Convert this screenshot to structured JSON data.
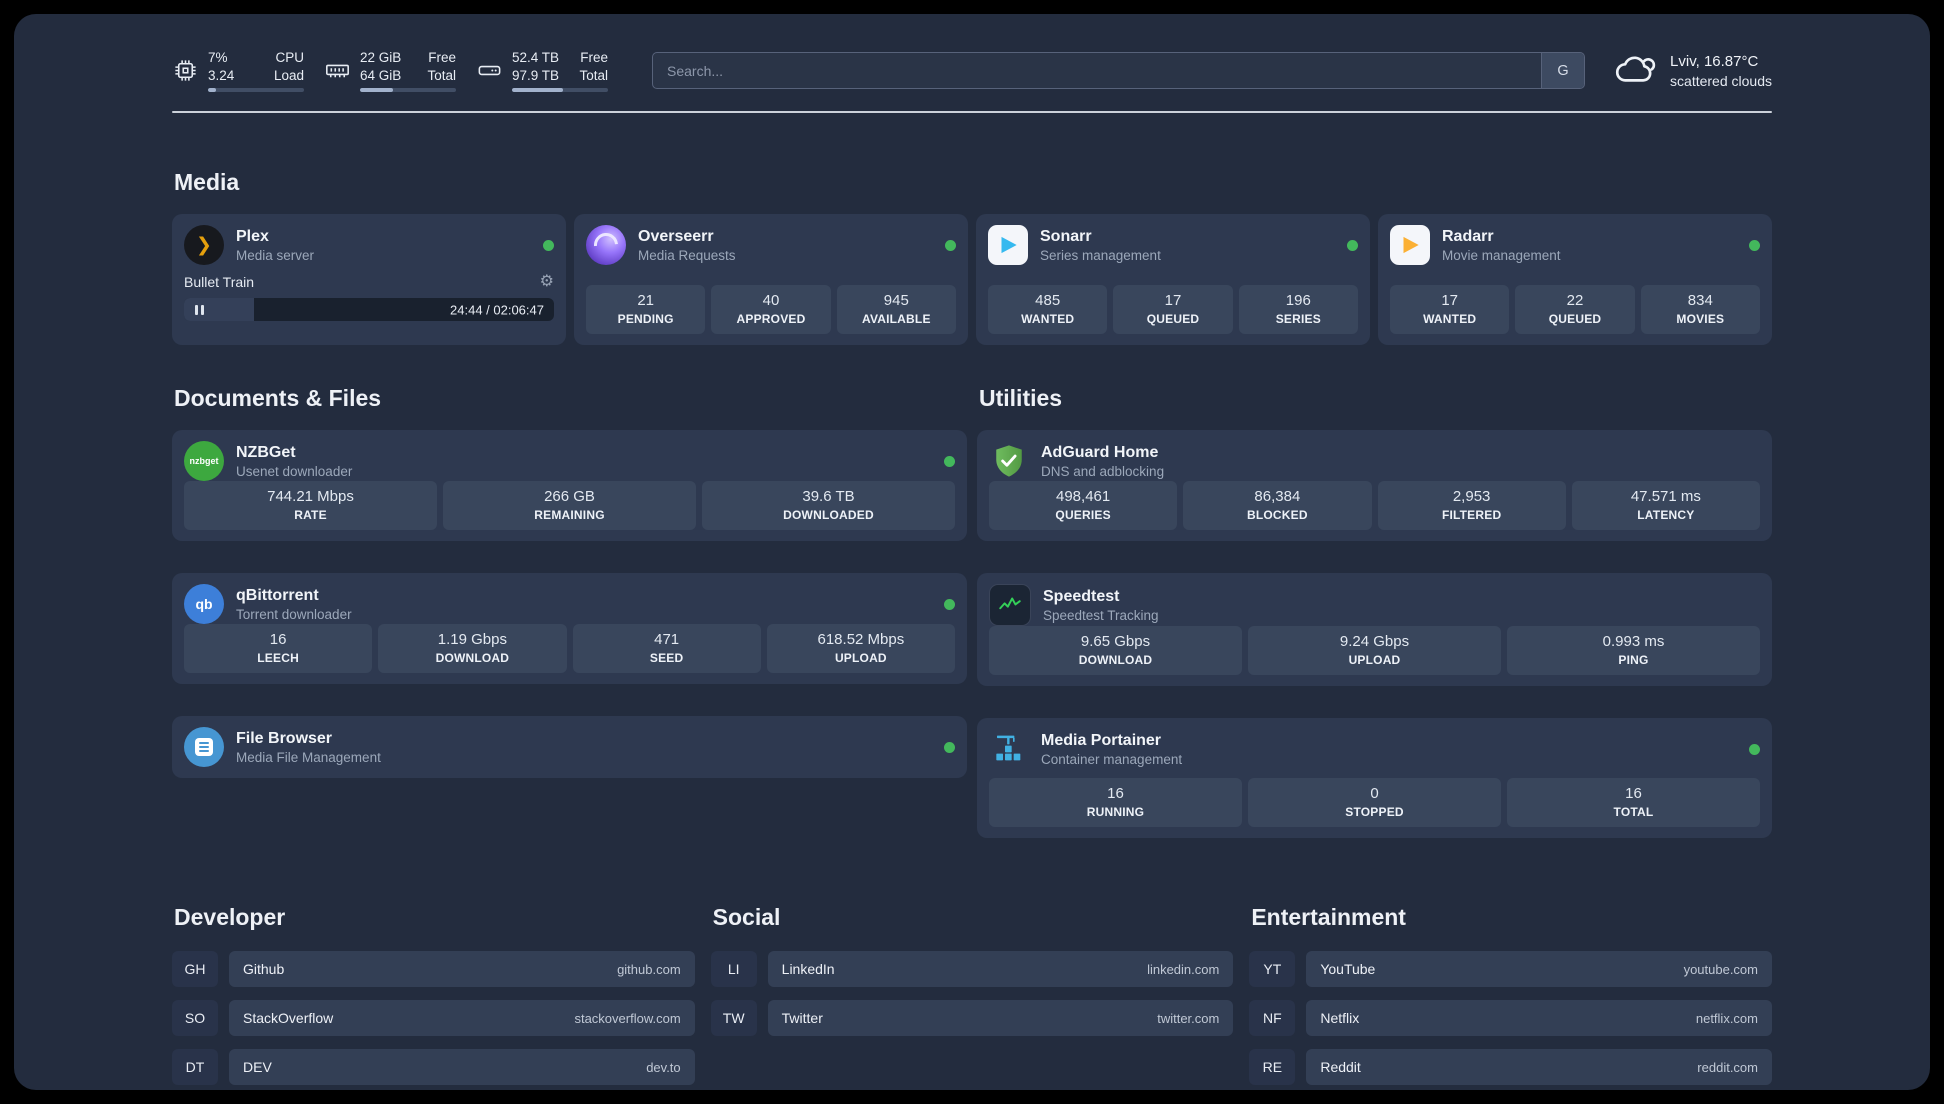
{
  "colors": {
    "background": "#232c3e",
    "card": "#2e3950",
    "stat_tile": "#39465c",
    "status_online": "#43b85c",
    "plex_accent": "#e5a00d",
    "adguard_green": "#67b55c",
    "portainer_blue": "#41b1e3"
  },
  "header": {
    "cpu": {
      "percent": "7%",
      "load": "3.24",
      "label_top": "CPU",
      "label_bottom": "Load"
    },
    "ram": {
      "value_top": "22 GiB",
      "value_bottom": "64 GiB",
      "label_top": "Free",
      "label_bottom": "Total"
    },
    "disk": {
      "value_top": "52.4 TB",
      "value_bottom": "97.9 TB",
      "label_top": "Free",
      "label_bottom": "Total"
    },
    "search": {
      "placeholder": "Search...",
      "engine": "G"
    },
    "weather": {
      "location": "Lviv, 16.87°C",
      "condition": "scattered clouds"
    }
  },
  "sections": {
    "media": "Media",
    "documents": "Documents & Files",
    "utilities": "Utilities",
    "developer": "Developer",
    "social": "Social",
    "entertainment": "Entertainment"
  },
  "media": {
    "plex": {
      "name": "Plex",
      "subtitle": "Media server",
      "track": "Bullet Train",
      "time": "24:44 / 02:06:47"
    },
    "overseerr": {
      "name": "Overseerr",
      "subtitle": "Media Requests",
      "stats": [
        {
          "value": "21",
          "label": "PENDING"
        },
        {
          "value": "40",
          "label": "APPROVED"
        },
        {
          "value": "945",
          "label": "AVAILABLE"
        }
      ]
    },
    "sonarr": {
      "name": "Sonarr",
      "subtitle": "Series management",
      "stats": [
        {
          "value": "485",
          "label": "WANTED"
        },
        {
          "value": "17",
          "label": "QUEUED"
        },
        {
          "value": "196",
          "label": "SERIES"
        }
      ]
    },
    "radarr": {
      "name": "Radarr",
      "subtitle": "Movie management",
      "stats": [
        {
          "value": "17",
          "label": "WANTED"
        },
        {
          "value": "22",
          "label": "QUEUED"
        },
        {
          "value": "834",
          "label": "MOVIES"
        }
      ]
    }
  },
  "documents": {
    "nzbget": {
      "name": "NZBGet",
      "subtitle": "Usenet downloader",
      "icon_text": "nzbget",
      "stats": [
        {
          "value": "744.21 Mbps",
          "label": "RATE"
        },
        {
          "value": "266 GB",
          "label": "REMAINING"
        },
        {
          "value": "39.6 TB",
          "label": "DOWNLOADED"
        }
      ]
    },
    "qbittorrent": {
      "name": "qBittorrent",
      "subtitle": "Torrent downloader",
      "icon_text": "qb",
      "stats": [
        {
          "value": "16",
          "label": "LEECH"
        },
        {
          "value": "1.19 Gbps",
          "label": "DOWNLOAD"
        },
        {
          "value": "471",
          "label": "SEED"
        },
        {
          "value": "618.52 Mbps",
          "label": "UPLOAD"
        }
      ]
    },
    "filebrowser": {
      "name": "File Browser",
      "subtitle": "Media File Management"
    }
  },
  "utilities": {
    "adguard": {
      "name": "AdGuard Home",
      "subtitle": "DNS and adblocking",
      "stats": [
        {
          "value": "498,461",
          "label": "QUERIES"
        },
        {
          "value": "86,384",
          "label": "BLOCKED"
        },
        {
          "value": "2,953",
          "label": "FILTERED"
        },
        {
          "value": "47.571 ms",
          "label": "LATENCY"
        }
      ]
    },
    "speedtest": {
      "name": "Speedtest",
      "subtitle": "Speedtest Tracking",
      "stats": [
        {
          "value": "9.65 Gbps",
          "label": "DOWNLOAD"
        },
        {
          "value": "9.24 Gbps",
          "label": "UPLOAD"
        },
        {
          "value": "0.993 ms",
          "label": "PING"
        }
      ]
    },
    "portainer": {
      "name": "Media Portainer",
      "subtitle": "Container management",
      "stats": [
        {
          "value": "16",
          "label": "RUNNING"
        },
        {
          "value": "0",
          "label": "STOPPED"
        },
        {
          "value": "16",
          "label": "TOTAL"
        }
      ]
    }
  },
  "bookmarks": {
    "developer": [
      {
        "abbr": "GH",
        "name": "Github",
        "url": "github.com"
      },
      {
        "abbr": "SO",
        "name": "StackOverflow",
        "url": "stackoverflow.com"
      },
      {
        "abbr": "DT",
        "name": "DEV",
        "url": "dev.to"
      }
    ],
    "social": [
      {
        "abbr": "LI",
        "name": "LinkedIn",
        "url": "linkedin.com"
      },
      {
        "abbr": "TW",
        "name": "Twitter",
        "url": "twitter.com"
      }
    ],
    "entertainment": [
      {
        "abbr": "YT",
        "name": "YouTube",
        "url": "youtube.com"
      },
      {
        "abbr": "NF",
        "name": "Netflix",
        "url": "netflix.com"
      },
      {
        "abbr": "RE",
        "name": "Reddit",
        "url": "reddit.com"
      }
    ]
  }
}
